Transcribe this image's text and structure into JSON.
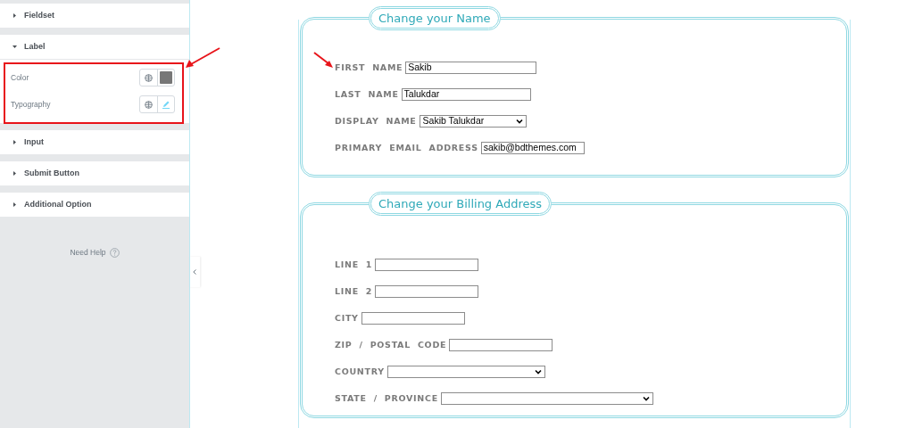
{
  "sidebar": {
    "sections": [
      {
        "title": "Fieldset",
        "expanded": false
      },
      {
        "title": "Label",
        "expanded": true,
        "controls": [
          {
            "label": "Color",
            "kind": "color"
          },
          {
            "label": "Typography",
            "kind": "typography"
          }
        ]
      },
      {
        "title": "Input",
        "expanded": false
      },
      {
        "title": "Submit Button",
        "expanded": false
      },
      {
        "title": "Additional Option",
        "expanded": false
      }
    ],
    "help": "Need Help"
  },
  "form": {
    "fieldsets": [
      {
        "legend": "Change your Name",
        "fields": [
          {
            "label": "FIRST  NAME",
            "kind": "text",
            "value": "Sakib"
          },
          {
            "label": "LAST  NAME",
            "kind": "text",
            "value": "Talukdar"
          },
          {
            "label": "DISPLAY  NAME",
            "kind": "select",
            "value": "Sakib Talukdar"
          },
          {
            "label": "PRIMARY  EMAIL  ADDRESS",
            "kind": "text",
            "value": "sakib@bdthemes.com"
          }
        ]
      },
      {
        "legend": "Change your Billing Address",
        "fields": [
          {
            "label": "LINE  1",
            "kind": "text"
          },
          {
            "label": "LINE  2",
            "kind": "text"
          },
          {
            "label": "CITY",
            "kind": "text"
          },
          {
            "label": "ZIP  /  POSTAL  CODE",
            "kind": "text"
          },
          {
            "label": "COUNTRY",
            "kind": "select"
          },
          {
            "label": "STATE  /  PROVINCE",
            "kind": "select"
          }
        ]
      }
    ]
  }
}
